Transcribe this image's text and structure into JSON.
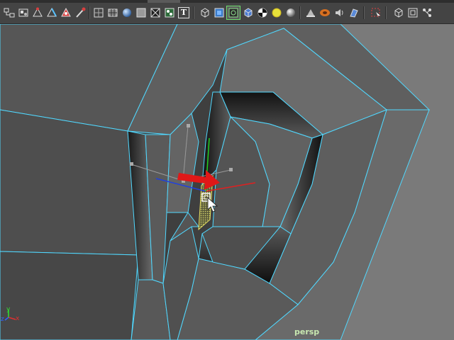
{
  "viewport": {
    "camera_label": "persp"
  },
  "axis_gizmo": {
    "x_label": "x",
    "y_label": "y",
    "z_label": "z"
  },
  "toolbar": {
    "text_tool_glyph": "T",
    "buttons": [
      "select-by-hierarchy-icon",
      "select-by-component-icon",
      "select-vertex-icon",
      "select-edge-icon",
      "select-face-icon",
      "select-uv-icon",
      "wireframe-icon",
      "smooth-shade-all-icon",
      "smooth-shade-selected-icon",
      "flat-shade-icon",
      "texture-icon",
      "text-icon",
      "cube-icon",
      "sphere-poly-icon",
      "cylinder-icon",
      "plane-icon",
      "checker-icon",
      "light-icon",
      "sphere-icon",
      "camera-icon",
      "render-icon",
      "audio-icon",
      "film-icon",
      "select-camera-icon",
      "isolate-select-icon",
      "xray-icon",
      "xray-joints-icon"
    ]
  }
}
